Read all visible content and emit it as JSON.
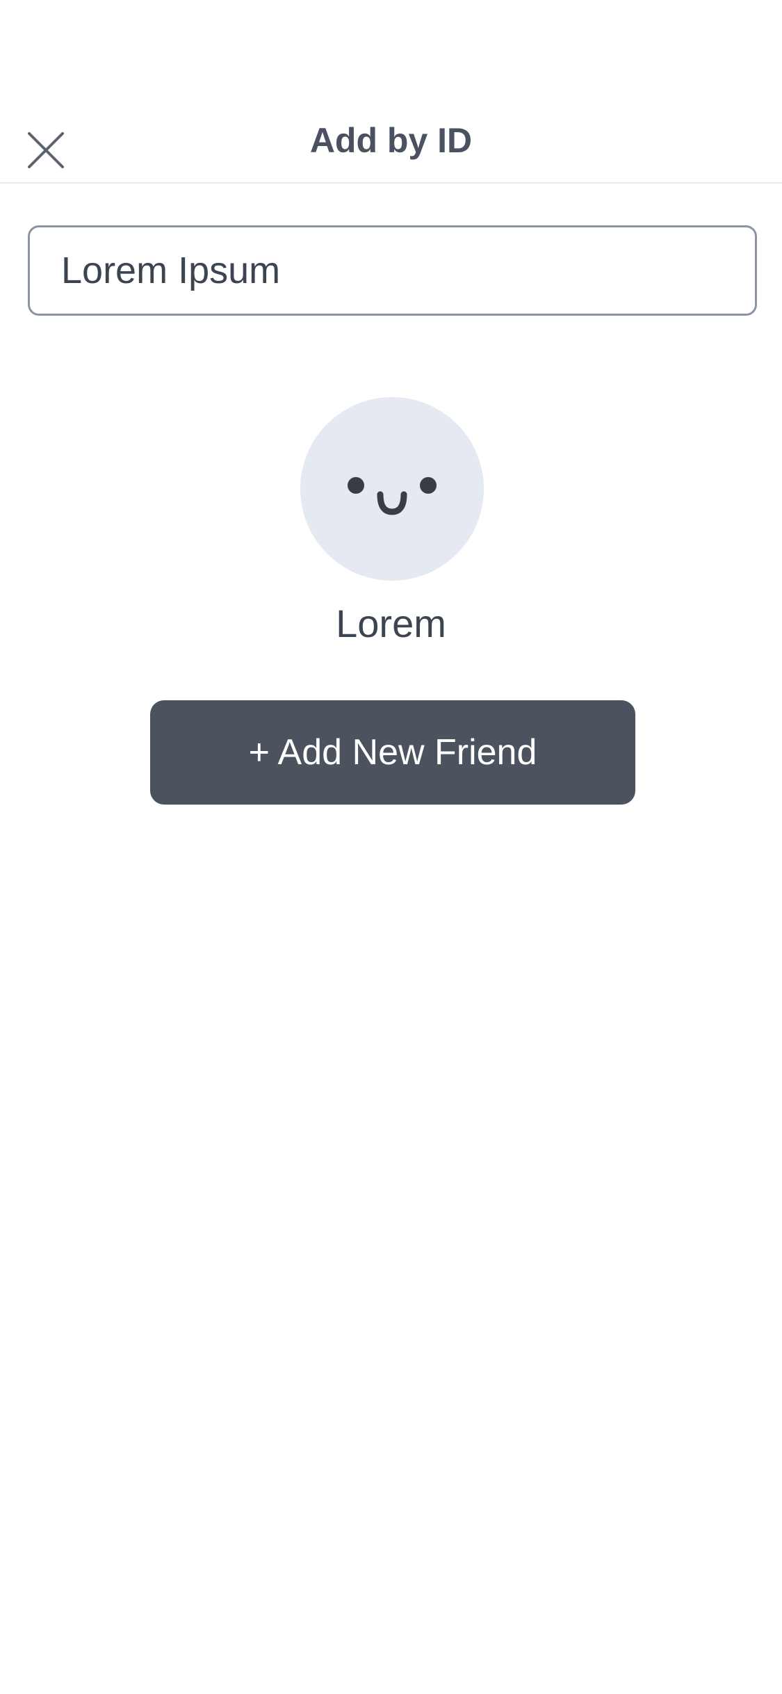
{
  "header": {
    "title": "Add by ID",
    "close_icon": "close-icon"
  },
  "search": {
    "value": "Lorem Ipsum",
    "placeholder": ""
  },
  "result": {
    "avatar_icon": "smiley-face-icon",
    "name": "Lorem"
  },
  "actions": {
    "add_friend_label": "+ Add New Friend"
  },
  "colors": {
    "text": "#3d4451",
    "title": "#4a5260",
    "input_border": "#8a94a3",
    "avatar_bg": "#e5e9f2",
    "button_bg": "#4b535f",
    "button_text": "#ffffff",
    "divider": "#e8eaee"
  }
}
